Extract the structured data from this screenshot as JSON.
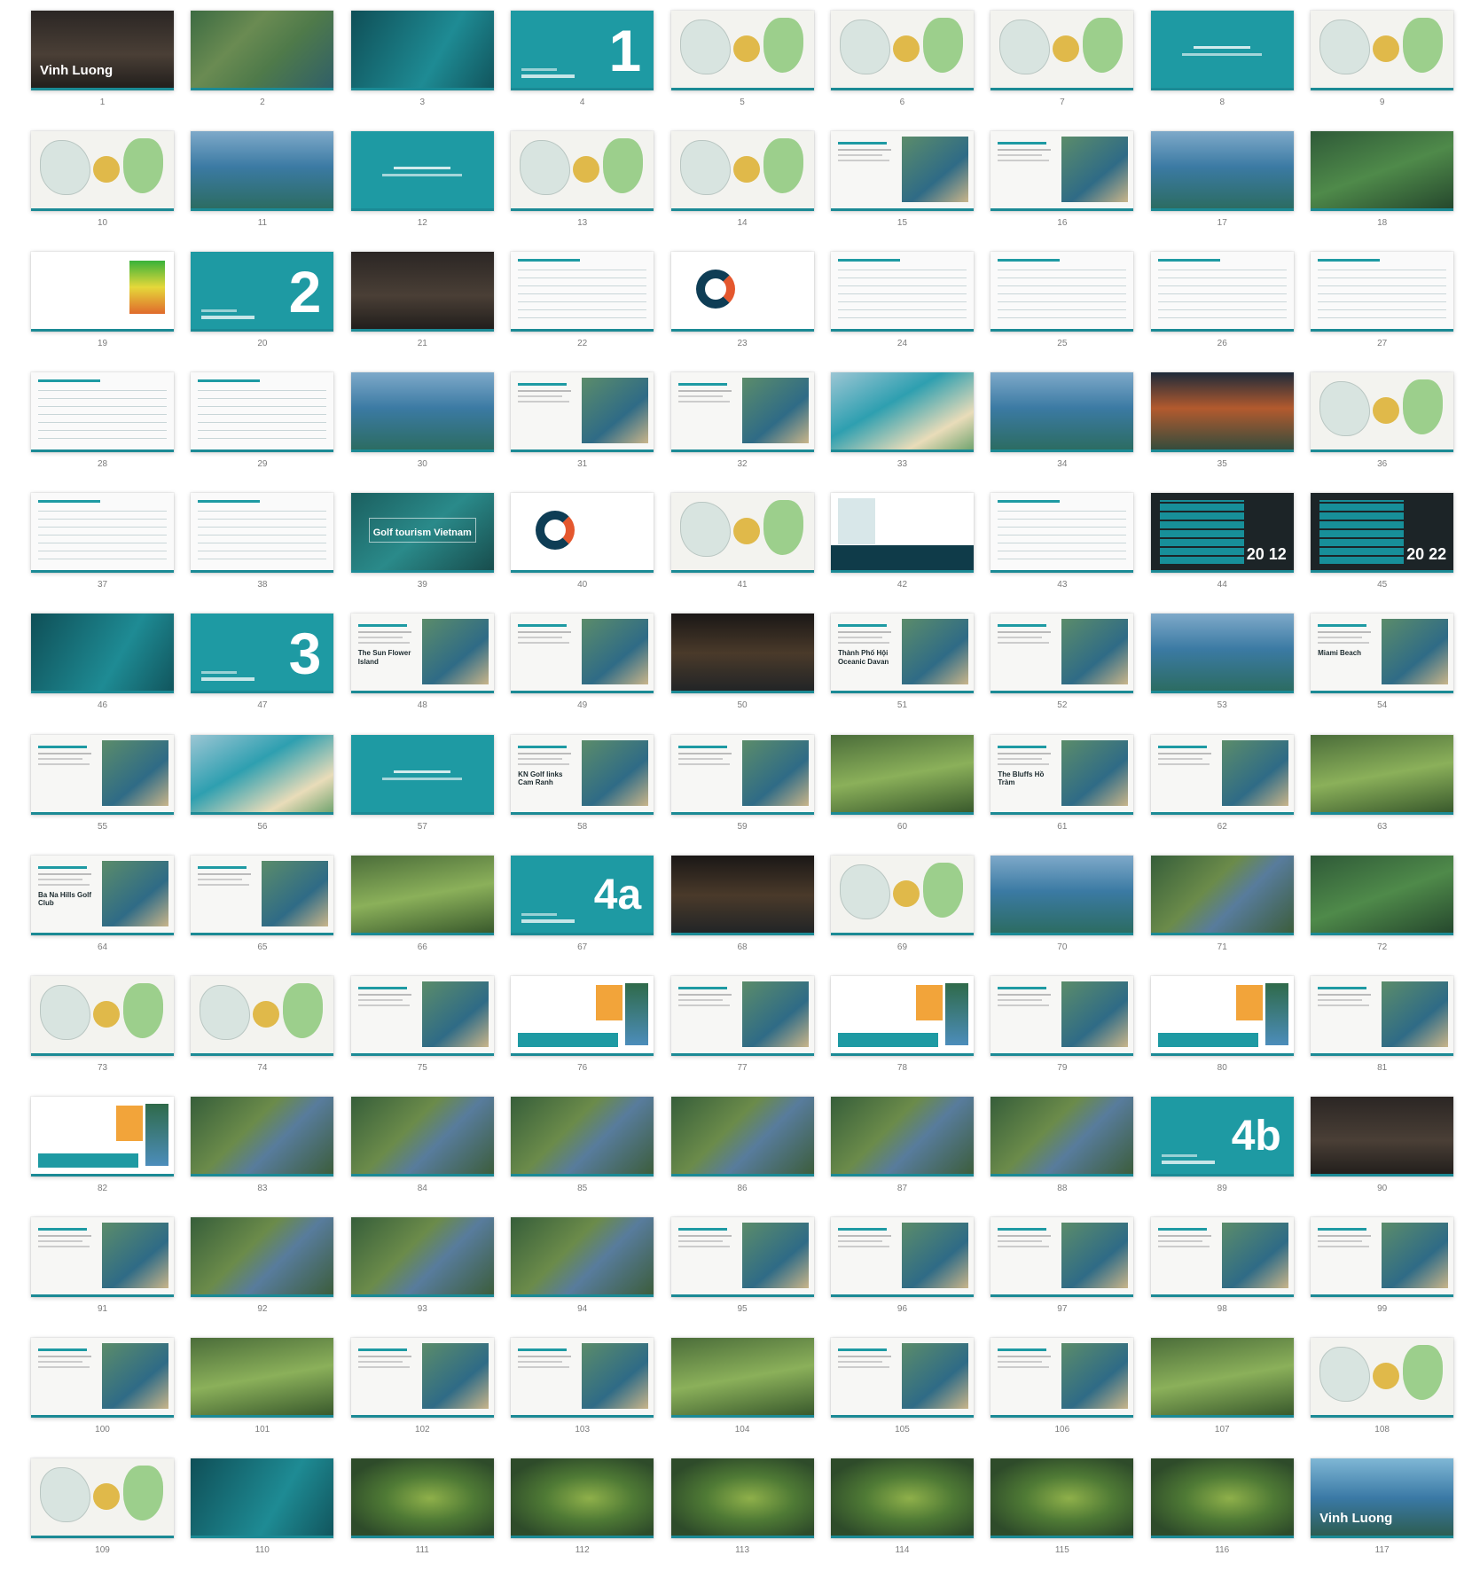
{
  "slides": [
    {
      "number": "1",
      "style": "dark",
      "title": "Vinh Luong"
    },
    {
      "number": "2",
      "style": "aerial"
    },
    {
      "number": "3",
      "style": "darkteal"
    },
    {
      "number": "4",
      "style": "teal",
      "big": "1"
    },
    {
      "number": "5",
      "style": "map"
    },
    {
      "number": "6",
      "style": "map"
    },
    {
      "number": "7",
      "style": "map"
    },
    {
      "number": "8",
      "style": "tealtext"
    },
    {
      "number": "9",
      "style": "map"
    },
    {
      "number": "10",
      "style": "map"
    },
    {
      "number": "11",
      "style": "sea"
    },
    {
      "number": "12",
      "style": "tealtext"
    },
    {
      "number": "13",
      "style": "map"
    },
    {
      "number": "14",
      "style": "map"
    },
    {
      "number": "15",
      "style": "photo"
    },
    {
      "number": "16",
      "style": "photo"
    },
    {
      "number": "17",
      "style": "sea"
    },
    {
      "number": "18",
      "style": "forest"
    },
    {
      "number": "19",
      "style": "chart-heat"
    },
    {
      "number": "20",
      "style": "teal",
      "big": "2"
    },
    {
      "number": "21",
      "style": "dark"
    },
    {
      "number": "22",
      "style": "table"
    },
    {
      "number": "23",
      "style": "chart-donut"
    },
    {
      "number": "24",
      "style": "table"
    },
    {
      "number": "25",
      "style": "table"
    },
    {
      "number": "26",
      "style": "table"
    },
    {
      "number": "27",
      "style": "table"
    },
    {
      "number": "28",
      "style": "table"
    },
    {
      "number": "29",
      "style": "table"
    },
    {
      "number": "30",
      "style": "sea"
    },
    {
      "number": "31",
      "style": "photo"
    },
    {
      "number": "32",
      "style": "photo"
    },
    {
      "number": "33",
      "style": "coast"
    },
    {
      "number": "34",
      "style": "sea"
    },
    {
      "number": "35",
      "style": "sunset"
    },
    {
      "number": "36",
      "style": "map"
    },
    {
      "number": "37",
      "style": "table"
    },
    {
      "number": "38",
      "style": "table"
    },
    {
      "number": "39",
      "style": "golfvn",
      "label": "Golf tourism Vietnam"
    },
    {
      "number": "40",
      "style": "chart-donut"
    },
    {
      "number": "41",
      "style": "map"
    },
    {
      "number": "42",
      "style": "vt"
    },
    {
      "number": "43",
      "style": "table"
    },
    {
      "number": "44",
      "style": "year",
      "label": "20 12"
    },
    {
      "number": "45",
      "style": "year",
      "label": "20 22"
    },
    {
      "number": "46",
      "style": "darkteal"
    },
    {
      "number": "47",
      "style": "teal",
      "big": "3"
    },
    {
      "number": "48",
      "style": "photo",
      "heading": "The Sun Flower Island"
    },
    {
      "number": "49",
      "style": "photo"
    },
    {
      "number": "50",
      "style": "night"
    },
    {
      "number": "51",
      "style": "photo",
      "heading": "Thành Phố Hội Oceanic Davan"
    },
    {
      "number": "52",
      "style": "photo"
    },
    {
      "number": "53",
      "style": "sea"
    },
    {
      "number": "54",
      "style": "photo",
      "heading": "Miami Beach"
    },
    {
      "number": "55",
      "style": "photo"
    },
    {
      "number": "56",
      "style": "coast"
    },
    {
      "number": "57",
      "style": "tealtext"
    },
    {
      "number": "58",
      "style": "photo",
      "heading": "KN Golf links Cam Ranh"
    },
    {
      "number": "59",
      "style": "photo"
    },
    {
      "number": "60",
      "style": "golf"
    },
    {
      "number": "61",
      "style": "photo",
      "heading": "The Bluffs Hồ Tràm"
    },
    {
      "number": "62",
      "style": "photo"
    },
    {
      "number": "63",
      "style": "golf"
    },
    {
      "number": "64",
      "style": "photo",
      "heading": "Ba Na Hills Golf Club"
    },
    {
      "number": "65",
      "style": "photo"
    },
    {
      "number": "66",
      "style": "golf"
    },
    {
      "number": "67",
      "style": "teal",
      "big": "4a"
    },
    {
      "number": "68",
      "style": "night"
    },
    {
      "number": "69",
      "style": "map"
    },
    {
      "number": "70",
      "style": "sea"
    },
    {
      "number": "71",
      "style": "estuary"
    },
    {
      "number": "72",
      "style": "forest"
    },
    {
      "number": "73",
      "style": "map"
    },
    {
      "number": "74",
      "style": "map"
    },
    {
      "number": "75",
      "style": "photo"
    },
    {
      "number": "76",
      "style": "orange"
    },
    {
      "number": "77",
      "style": "photo"
    },
    {
      "number": "78",
      "style": "orange"
    },
    {
      "number": "79",
      "style": "photo"
    },
    {
      "number": "80",
      "style": "orange"
    },
    {
      "number": "81",
      "style": "photo"
    },
    {
      "number": "82",
      "style": "orange"
    },
    {
      "number": "83",
      "style": "estuary"
    },
    {
      "number": "84",
      "style": "estuary"
    },
    {
      "number": "85",
      "style": "estuary"
    },
    {
      "number": "86",
      "style": "estuary"
    },
    {
      "number": "87",
      "style": "estuary"
    },
    {
      "number": "88",
      "style": "estuary"
    },
    {
      "number": "89",
      "style": "teal",
      "big": "4b"
    },
    {
      "number": "90",
      "style": "dark"
    },
    {
      "number": "91",
      "style": "photo"
    },
    {
      "number": "92",
      "style": "estuary"
    },
    {
      "number": "93",
      "style": "estuary"
    },
    {
      "number": "94",
      "style": "estuary"
    },
    {
      "number": "95",
      "style": "photo"
    },
    {
      "number": "96",
      "style": "photo"
    },
    {
      "number": "97",
      "style": "photo"
    },
    {
      "number": "98",
      "style": "photo"
    },
    {
      "number": "99",
      "style": "photo"
    },
    {
      "number": "100",
      "style": "photo"
    },
    {
      "number": "101",
      "style": "golf"
    },
    {
      "number": "102",
      "style": "photo"
    },
    {
      "number": "103",
      "style": "photo"
    },
    {
      "number": "104",
      "style": "golf"
    },
    {
      "number": "105",
      "style": "photo"
    },
    {
      "number": "106",
      "style": "photo"
    },
    {
      "number": "107",
      "style": "golf"
    },
    {
      "number": "108",
      "style": "map"
    },
    {
      "number": "109",
      "style": "map"
    },
    {
      "number": "110",
      "style": "darkteal"
    },
    {
      "number": "111",
      "style": "satgreen"
    },
    {
      "number": "112",
      "style": "satgreen"
    },
    {
      "number": "113",
      "style": "satgreen"
    },
    {
      "number": "114",
      "style": "satgreen"
    },
    {
      "number": "115",
      "style": "satgreen"
    },
    {
      "number": "116",
      "style": "satgreen"
    },
    {
      "number": "117",
      "style": "coverend",
      "title": "Vinh Luong"
    }
  ]
}
